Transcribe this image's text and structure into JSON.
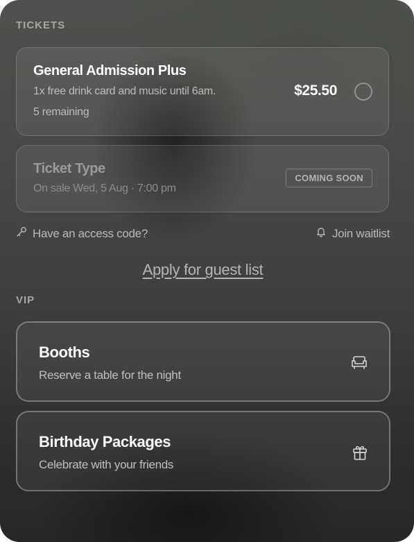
{
  "tickets_section": {
    "label": "TICKETS",
    "items": [
      {
        "name": "General Admission Plus",
        "description": "1x free drink card and music until 6am.",
        "remaining": "5 remaining",
        "price": "$25.50",
        "selected": false
      },
      {
        "name": "Ticket Type",
        "sale_info": "On sale Wed, 5 Aug · 7:00 pm",
        "badge": "COMING SOON"
      }
    ]
  },
  "links": {
    "access_code": "Have an access code?",
    "waitlist": "Join waitlist",
    "guest_list": "Apply for guest list"
  },
  "vip_section": {
    "label": "VIP",
    "items": [
      {
        "title": "Booths",
        "subtitle": "Reserve a table for the night",
        "icon": "sofa-icon"
      },
      {
        "title": "Birthday Packages",
        "subtitle": "Celebrate with your friends",
        "icon": "gift-icon"
      }
    ]
  }
}
